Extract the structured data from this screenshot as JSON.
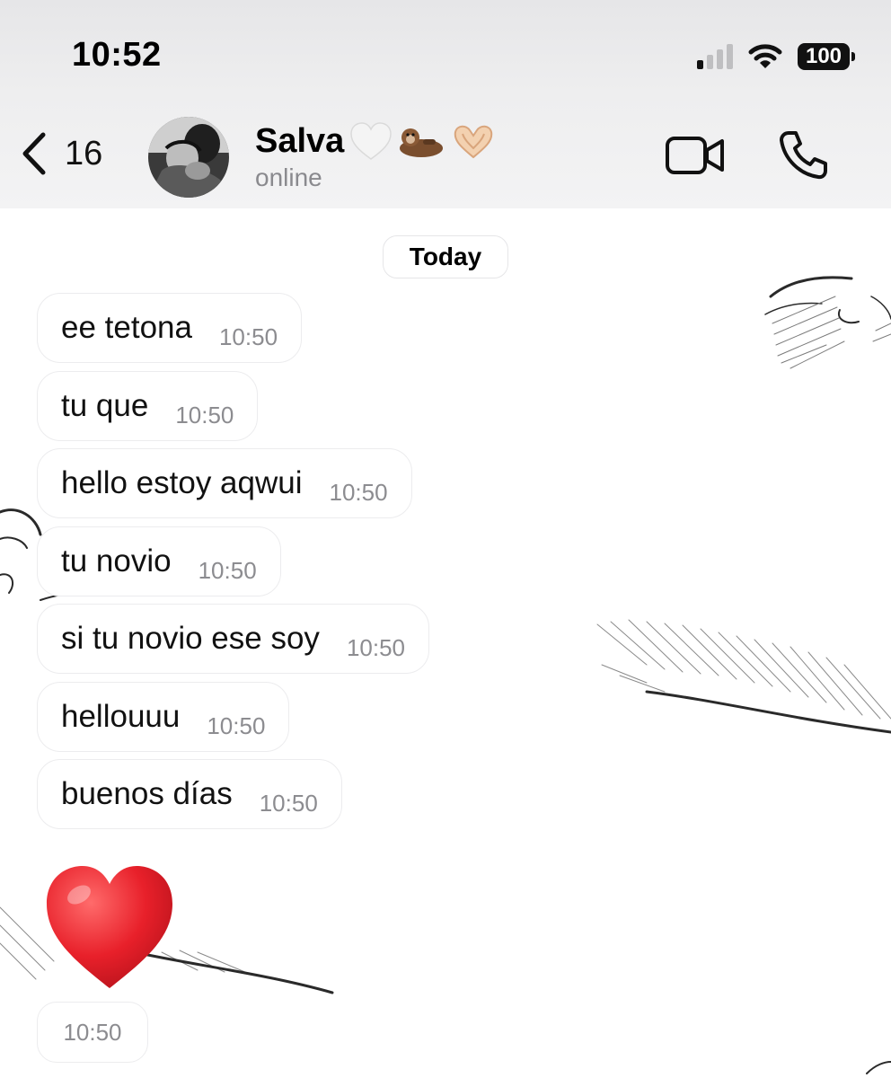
{
  "status_bar": {
    "time": "10:52",
    "battery": "100",
    "signal_bars_active": 1
  },
  "header": {
    "back_count": "16",
    "contact_name": "Salva",
    "name_emojis": [
      "🤍",
      "🦦",
      "🫶🏼"
    ],
    "contact_status": "online",
    "icons": [
      "back-chevron-icon",
      "video-camera-icon",
      "phone-icon"
    ]
  },
  "chat": {
    "date_label": "Today",
    "messages": [
      {
        "text": "ee tetona",
        "time": "10:50"
      },
      {
        "text": "tu que",
        "time": "10:50"
      },
      {
        "text": "hello estoy aqwui",
        "time": "10:50"
      },
      {
        "text": "tu novio",
        "time": "10:50"
      },
      {
        "text": "si tu novio ese soy",
        "time": "10:50"
      },
      {
        "text": "hellouuu",
        "time": "10:50"
      },
      {
        "text": "buenos días",
        "time": "10:50"
      }
    ],
    "heart_message": {
      "emoji": "❤️",
      "time": "10:50"
    }
  },
  "colors": {
    "header_bg": "#eeeeef",
    "bubble_bg": "#ffffff",
    "timestamp": "#8c8c90",
    "heart": "#e8202a"
  }
}
